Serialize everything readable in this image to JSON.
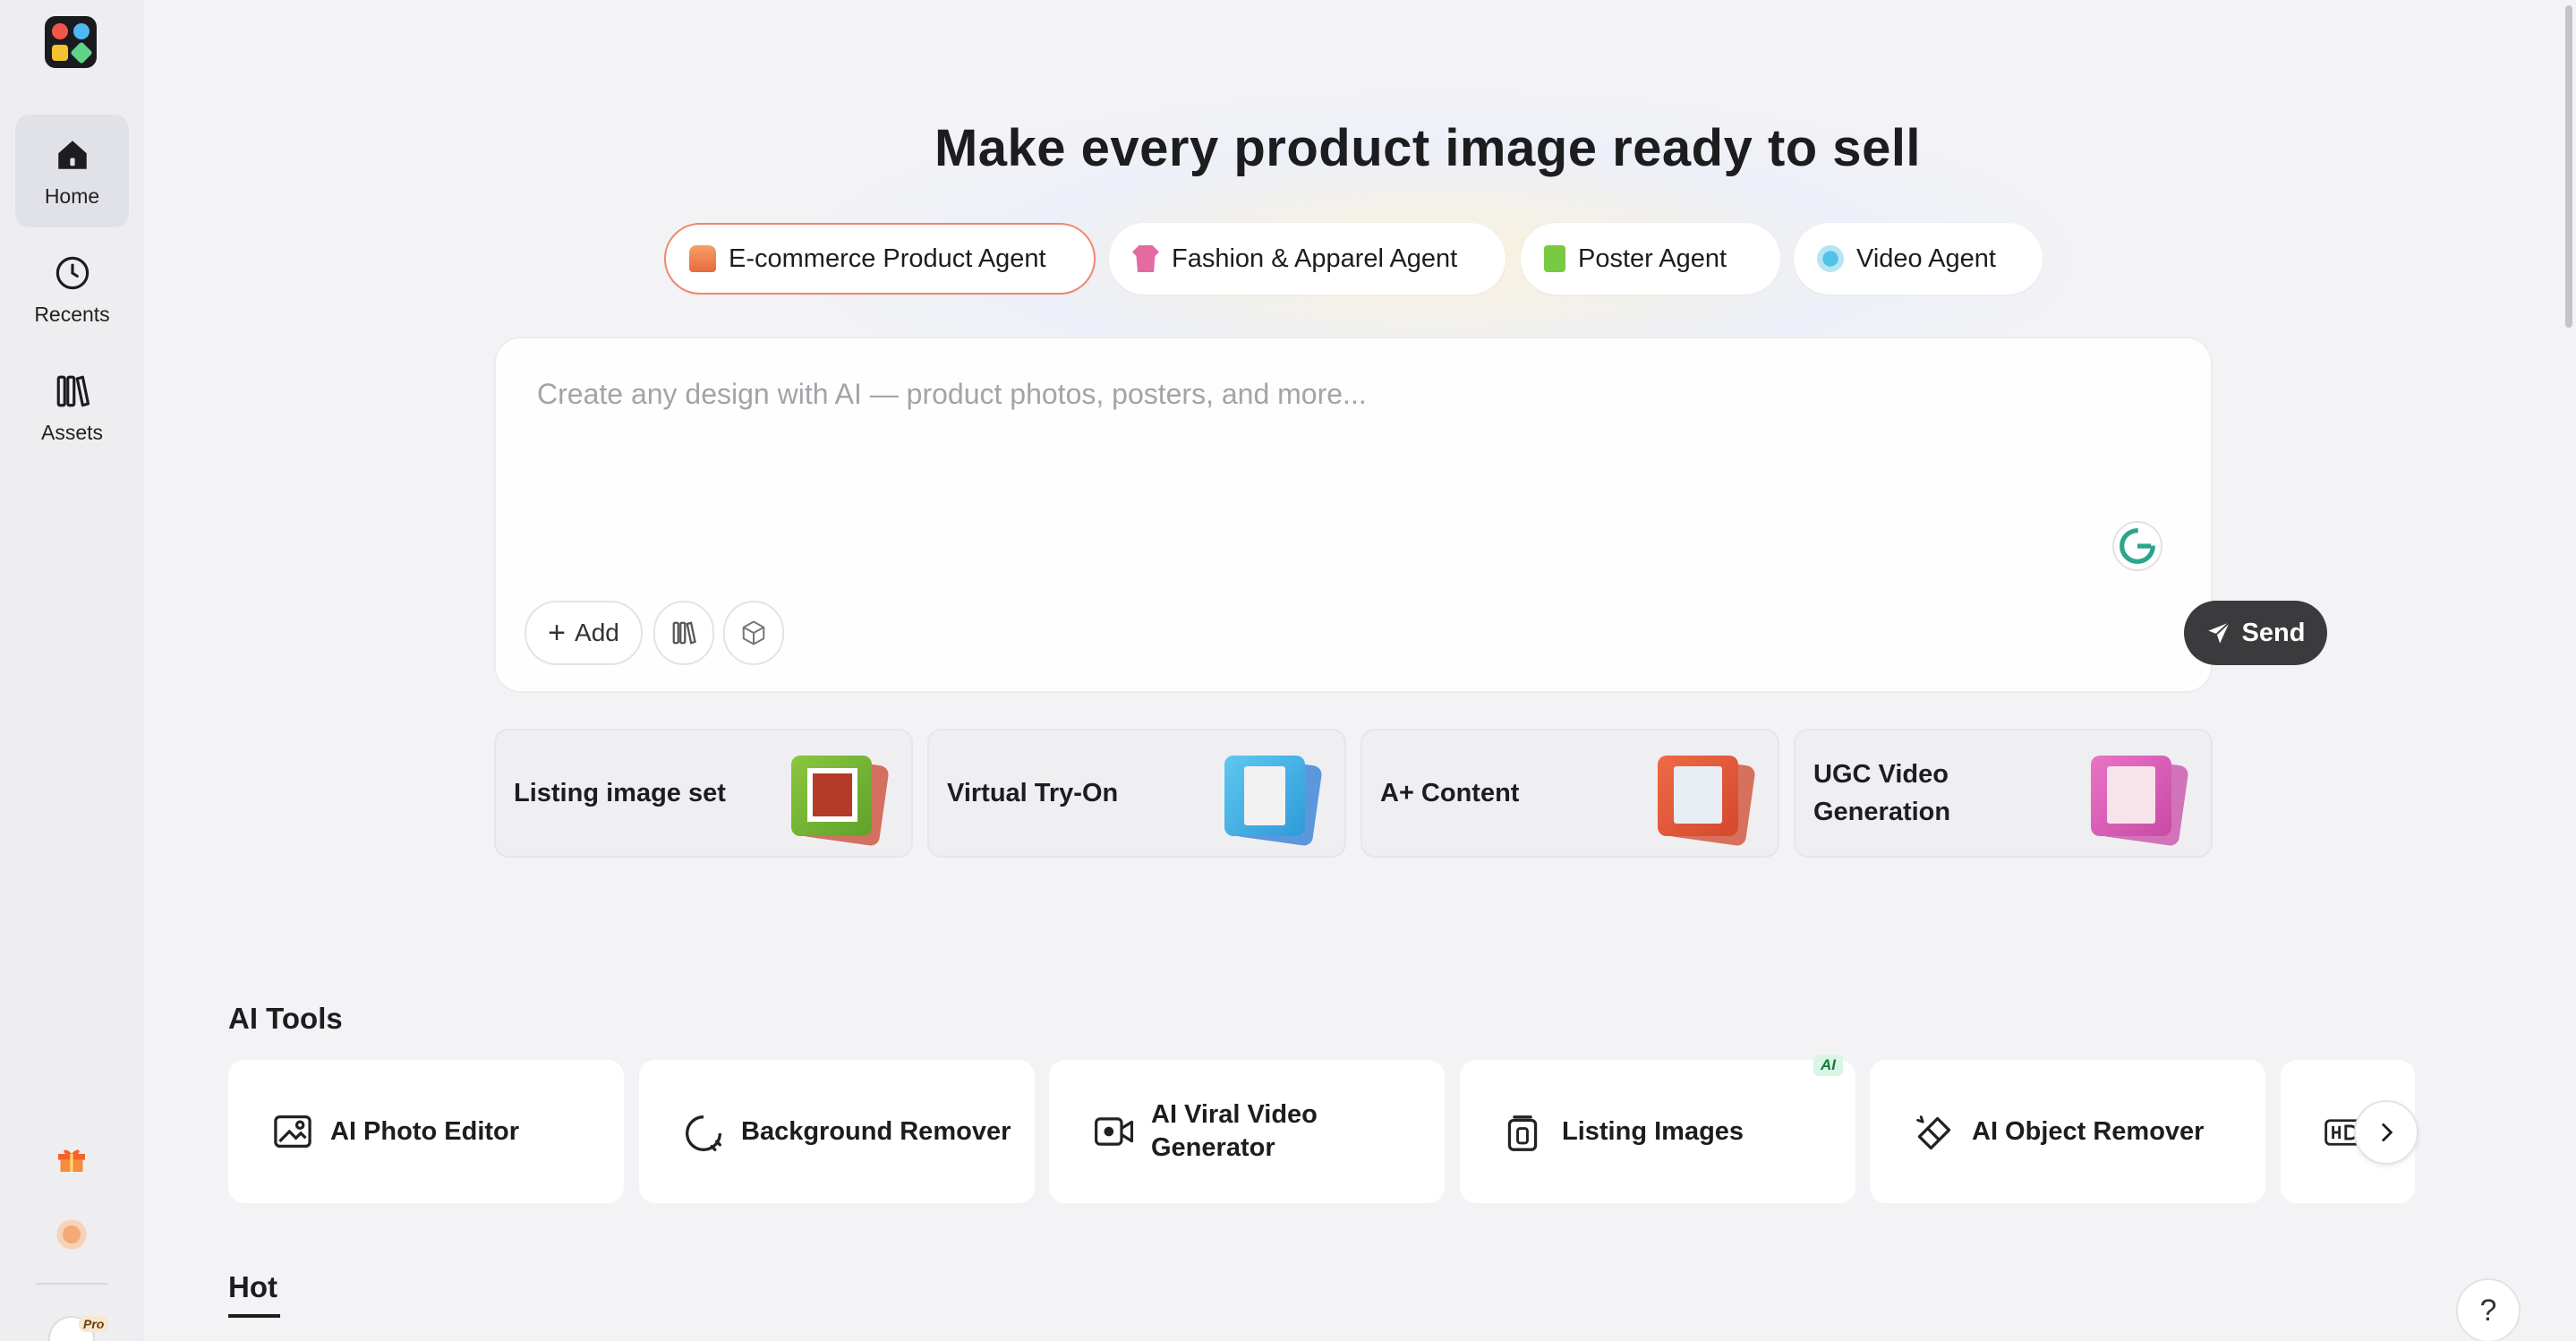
{
  "sidebar": {
    "items": [
      {
        "label": "Home",
        "icon": "home-icon",
        "active": true
      },
      {
        "label": "Recents",
        "icon": "clock-icon",
        "active": false
      },
      {
        "label": "Assets",
        "icon": "library-icon",
        "active": false
      }
    ],
    "pro_badge": "Pro"
  },
  "main": {
    "headline": "Make every product image ready to sell",
    "agent_tabs": [
      {
        "label": "E-commerce Product Agent",
        "icon": "sofa-icon",
        "active": true
      },
      {
        "label": "Fashion & Apparel Agent",
        "icon": "shirt-icon",
        "active": false
      },
      {
        "label": "Poster Agent",
        "icon": "poster-icon",
        "active": false
      },
      {
        "label": "Video Agent",
        "icon": "video-icon",
        "active": false
      }
    ],
    "prompt": {
      "placeholder": "Create any design with AI — product photos, posters, and more...",
      "value": "",
      "add_label": "Add",
      "send_label": "Send"
    },
    "quick_cards": [
      {
        "label": "Listing image set",
        "colors": [
          "#8bc63e",
          "#c9452e"
        ]
      },
      {
        "label": "Virtual Try-On",
        "colors": [
          "#3db4e8",
          "#2a7bd3"
        ]
      },
      {
        "label": "A+ Content",
        "colors": [
          "#e2543a",
          "#d0452c"
        ]
      },
      {
        "label": "UGC Video Generation",
        "colors": [
          "#e05ab8",
          "#c84aa6"
        ]
      }
    ],
    "ai_tools_title": "AI Tools",
    "tools": [
      {
        "label": "AI Photo Editor",
        "icon": "photo-edit-icon"
      },
      {
        "label": "Background Remover",
        "icon": "background-remove-icon"
      },
      {
        "label": "AI Viral Video Generator",
        "icon": "video-camera-icon"
      },
      {
        "label": "Listing Images",
        "icon": "listing-icon",
        "tag": "AI"
      },
      {
        "label": "AI Object Remover",
        "icon": "eraser-icon"
      }
    ],
    "hot_title": "Hot",
    "help_label": "?"
  },
  "colors": {
    "accent_border": "#f0856a",
    "send_button": "#3b3b3d",
    "background": "#f3f3f5"
  }
}
